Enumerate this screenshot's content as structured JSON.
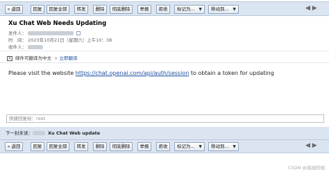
{
  "toolbar": {
    "buttons": [
      "« 返回",
      "回复",
      "回复全部",
      "转发",
      "删除",
      "彻底删除",
      "举报",
      "拒收",
      "标记为...",
      "移动到..."
    ],
    "nav_arrows": "◀ ▶"
  },
  "email": {
    "subject": "Xu Chat Web Needs Updating",
    "star": "☆",
    "sender_label": "发件人：",
    "time_label": "时　间：",
    "time_value": "2023年10月21日（星期六）上午10：38",
    "recipient_label": "收件人：",
    "translate_notice": "邮件可翻译为中文",
    "translate_link": "立即翻译",
    "close_x": "×",
    "body_prefix": "Please visit the website ",
    "body_link": "https://chat.openai.com/api/auth/session",
    "body_suffix": " to obtain a token for updating"
  },
  "quick_reply": {
    "placeholder": "快捷回复给：root"
  },
  "next_mail": {
    "label": "下一封未读：",
    "subject": "Xu Chat Web update"
  },
  "watermark": "CSDN @高旭的旭"
}
